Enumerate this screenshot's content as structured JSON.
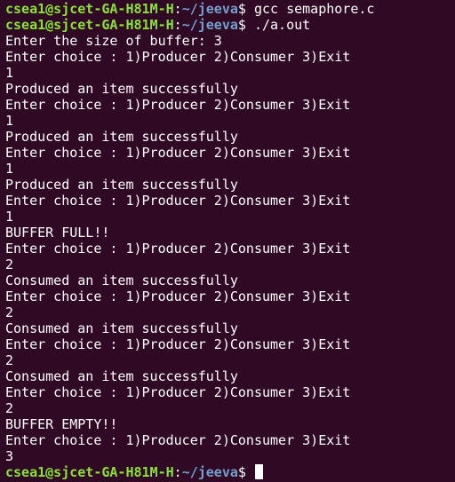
{
  "prompt": {
    "user_host": "csea1@sjcet-GA-H81M-H",
    "colon": ":",
    "path": "~/jeeva",
    "dollar": "$ "
  },
  "colors": {
    "background": "#300a24",
    "text": "#ffffff",
    "user_host": "#8ae234",
    "path": "#729fcf"
  },
  "commands": {
    "compile": "gcc semaphore.c",
    "run": "./a.out"
  },
  "output": [
    "Enter the size of buffer: 3",
    "Enter choice : 1)Producer 2)Consumer 3)Exit",
    "1",
    "Produced an item successfully",
    "Enter choice : 1)Producer 2)Consumer 3)Exit",
    "1",
    "Produced an item successfully",
    "Enter choice : 1)Producer 2)Consumer 3)Exit",
    "1",
    "Produced an item successfully",
    "Enter choice : 1)Producer 2)Consumer 3)Exit",
    "1",
    "BUFFER FULL!!",
    "Enter choice : 1)Producer 2)Consumer 3)Exit",
    "2",
    "Consumed an item successfully",
    "Enter choice : 1)Producer 2)Consumer 3)Exit",
    "2",
    "Consumed an item successfully",
    "Enter choice : 1)Producer 2)Consumer 3)Exit",
    "2",
    "Consumed an item successfully",
    "Enter choice : 1)Producer 2)Consumer 3)Exit",
    "2",
    "BUFFER EMPTY!!",
    "Enter choice : 1)Producer 2)Consumer 3)Exit",
    "3"
  ]
}
